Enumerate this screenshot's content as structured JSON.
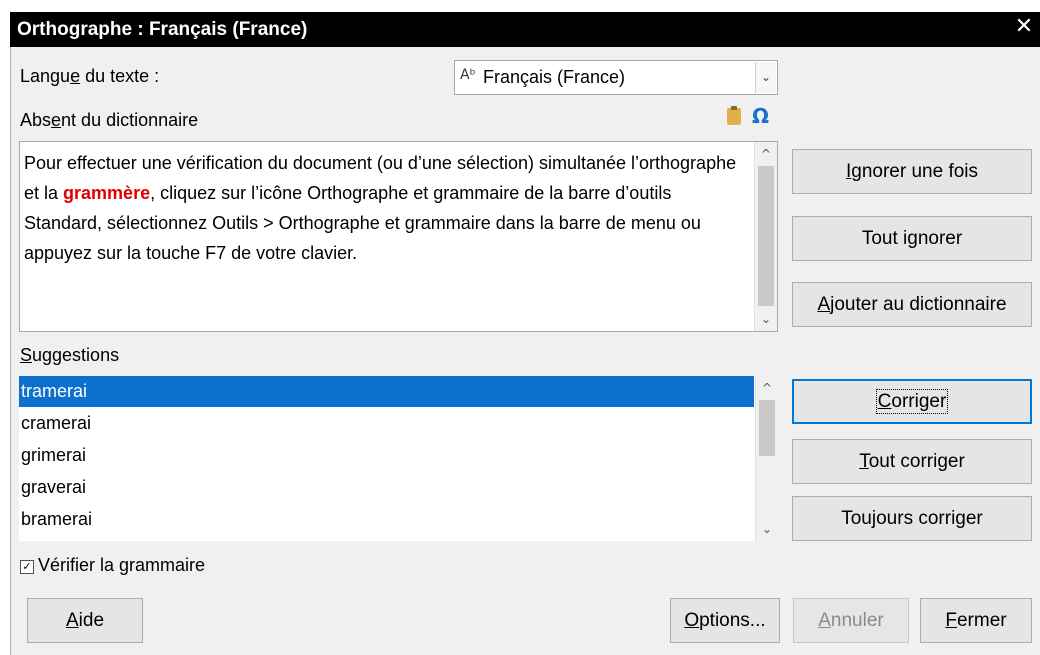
{
  "window": {
    "title": "Orthographe : Français (France)",
    "close_glyph": "✕"
  },
  "language": {
    "label_before": "Langu",
    "label_accel": "e",
    "label_after": " du texte :",
    "value": "Français (France)",
    "icon": "spellcheck-icon",
    "dropdown_glyph": "⌄"
  },
  "not_in_dict": {
    "label_before": "Abs",
    "label_accel": "e",
    "label_after": "nt du dictionnaire",
    "icons": [
      "clipboard-icon",
      "omega-icon"
    ],
    "omega_glyph": "Ω"
  },
  "text": {
    "part1": "Pour effectuer une vérification du document (ou d’une sélection) simultanée l’orthographe et la ",
    "error_word": "grammère",
    "part2": ", cliquez sur l’icône Orthographe et grammaire  de la barre d’outils Standard, sélectionnez Outils > Orthographe et grammaire dans la barre de menu ou appuyez sur la touche F7 de votre clavier."
  },
  "colors": {
    "error": "#e00000",
    "selection": "#0d6fce",
    "focus": "#0078d7",
    "titlebar": "#000000"
  },
  "suggestions": {
    "label_accel": "S",
    "label_after": "uggestions",
    "items": [
      "tramerai",
      "cramerai",
      "grimerai",
      "graverai",
      "bramerai"
    ],
    "selected_index": 0
  },
  "buttons": {
    "ignore_once": {
      "accel": "I",
      "rest": "gnorer une fois"
    },
    "ignore_all": {
      "before": "Tout i",
      "accel": "g",
      "after": "norer"
    },
    "add_dict": {
      "accel": "A",
      "rest": "jouter au dictionnaire"
    },
    "correct": {
      "accel": "C",
      "rest": "orriger"
    },
    "correct_all": {
      "accel": "T",
      "rest": "out corriger"
    },
    "always_correct": {
      "before": "Tou",
      "accel": "j",
      "after": "ours corriger"
    },
    "help": {
      "accel": "A",
      "rest": "ide"
    },
    "options": {
      "accel": "O",
      "rest": "ptions..."
    },
    "cancel": {
      "accel": "A",
      "rest": "nnuler"
    },
    "close": {
      "accel": "F",
      "rest": "ermer"
    }
  },
  "check_grammar": {
    "checked": true,
    "check_glyph": "✓",
    "accel": "V",
    "rest": "érifier la grammaire"
  },
  "scroll": {
    "up_glyph": "^",
    "down_glyph": "⌄"
  }
}
